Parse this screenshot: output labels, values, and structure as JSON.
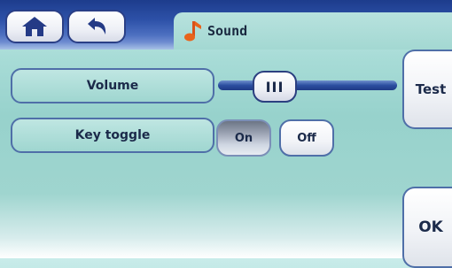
{
  "header": {
    "title": "Sound",
    "home_icon": "home-icon",
    "back_icon": "back-arrow-icon",
    "title_icon": "music-note-icon"
  },
  "settings": {
    "volume_label": "Volume",
    "volume_level": 0.21,
    "slider_thumb_label": "III",
    "key_toggle_label": "Key toggle",
    "toggle_on_label": "On",
    "toggle_off_label": "Off",
    "toggle_selected": "On"
  },
  "side_buttons": {
    "test_label": "Test",
    "ok_label": "OK"
  },
  "colors": {
    "accent_blue": "#2c4ea0",
    "note_orange": "#e8641c",
    "panel_teal": "#9fd6d0"
  }
}
